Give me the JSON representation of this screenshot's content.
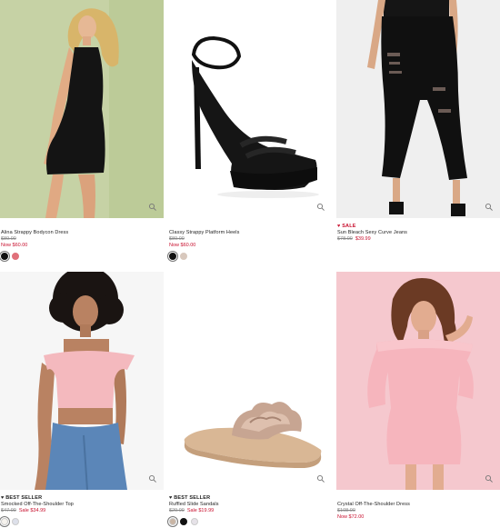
{
  "products": [
    {
      "name": "Alina Strappy Bodycon Dress",
      "badge": "",
      "was_price": "$89.00",
      "now_price": "Now $60.00",
      "swatches": [
        "#111111",
        "#e0707a"
      ],
      "image_bg": "#c8d3a8"
    },
    {
      "name": "Classy Strappy Platform Heels",
      "badge": "",
      "was_price": "$89.00",
      "now_price": "Now $60.00",
      "swatches": [
        "#111111",
        "#d8c8bd"
      ],
      "image_bg": "#ffffff"
    },
    {
      "name": "Sun Bleach Sexy Curve Jeans",
      "badge": "♥ SALE",
      "was_price": "$78.00",
      "now_price": "$39.99",
      "swatches": [],
      "image_bg": "#ededed"
    },
    {
      "name": "Smocked Off-The-Shoulder Top",
      "badge": "♥ BEST SELLER",
      "was_price": "$47.00",
      "now_price": "Sale $34.99",
      "swatches": [
        "#f6f3ee",
        "#dde0ea"
      ],
      "image_bg": "#f6f6f6"
    },
    {
      "name": "Ruffled Slide Sandals",
      "badge": "♥ BEST SELLER",
      "was_price": "$29.00",
      "now_price": "Sale $19.99",
      "swatches": [
        "#c9b5a4",
        "#111111",
        "#e6e2e8"
      ],
      "image_bg": "#ffffff"
    },
    {
      "name": "Crystal Off-The-Shoulder Dress",
      "badge": "",
      "was_price": "$108.00",
      "now_price": "Now $72.00",
      "swatches": [],
      "image_bg": "#f4c9cf"
    }
  ],
  "icons": {
    "zoom": "magnifier-icon"
  },
  "colors": {
    "sale_red": "#c8102e"
  }
}
